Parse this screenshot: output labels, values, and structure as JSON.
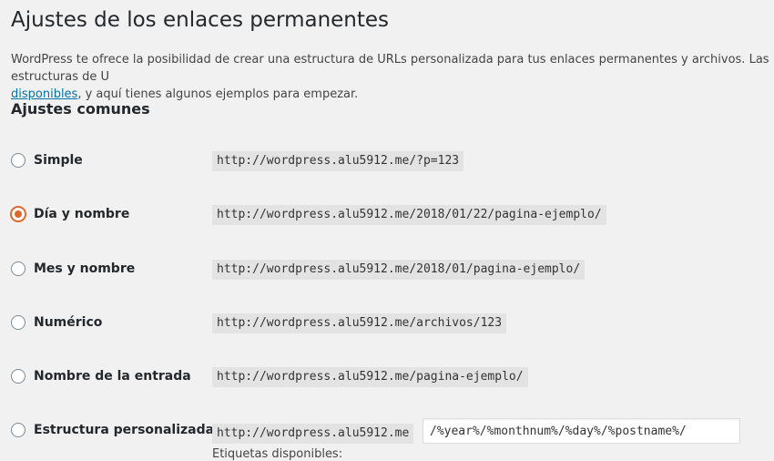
{
  "page": {
    "title": "Ajustes de los enlaces permanentes",
    "intro_text": "WordPress te ofrece la posibilidad de crear una estructura de URLs personalizada para tus enlaces permanentes y archivos. Las estructuras de U",
    "intro_link": "disponibles",
    "intro_rest": ", y aquí tienes algunos ejemplos para empezar."
  },
  "common": {
    "heading": "Ajustes comunes",
    "options": [
      {
        "label": "Simple",
        "url": "http://wordpress.alu5912.me/?p=123",
        "checked": false
      },
      {
        "label": "Día y nombre",
        "url": "http://wordpress.alu5912.me/2018/01/22/pagina-ejemplo/",
        "checked": true
      },
      {
        "label": "Mes y nombre",
        "url": "http://wordpress.alu5912.me/2018/01/pagina-ejemplo/",
        "checked": false
      },
      {
        "label": "Numérico",
        "url": "http://wordpress.alu5912.me/archivos/123",
        "checked": false
      },
      {
        "label": "Nombre de la entrada",
        "url": "http://wordpress.alu5912.me/pagina-ejemplo/",
        "checked": false
      },
      {
        "label": "Estructura personalizada",
        "url": "http://wordpress.alu5912.me",
        "checked": false
      }
    ],
    "custom_structure_value": "/%year%/%monthnum%/%day%/%postname%/",
    "tags_label": "Etiquetas disponibles:"
  },
  "colors": {
    "accent": "#dc6a2c",
    "link": "#0073aa",
    "background": "#f1f1f1"
  }
}
